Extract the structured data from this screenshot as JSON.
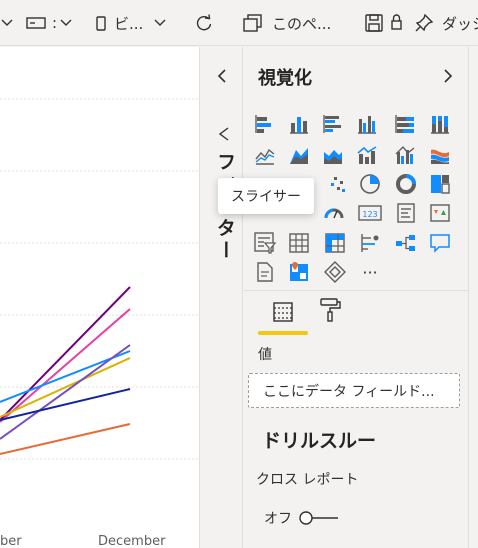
{
  "toolbar": {
    "item1_label": ":",
    "item2_label": "ビ...",
    "page_label": "このペ...",
    "item4_label": "ダッシ"
  },
  "visualizations": {
    "title": "視覚化",
    "tooltip": "スライサー",
    "more_label": "···"
  },
  "filters": {
    "vertical_label": "フィルター"
  },
  "fields": {
    "section_label": "値",
    "drop_placeholder": "ここにデータ フィールド..."
  },
  "drillthrough": {
    "title": "ドリルスルー",
    "cross_report_label": "クロス レポート",
    "toggle_state": "オフ"
  },
  "chart": {
    "x_label_left": "ber",
    "x_label_right": "December"
  },
  "colors": {
    "accent_yellow": "#f2c811",
    "icon_blue": "#118dff",
    "line_purple": "#6b007b",
    "line_pink": "#e044a7",
    "line_blue": "#118dff",
    "line_gold": "#d9b300",
    "line_violet": "#744ec2",
    "line_navy": "#12239e",
    "line_orange": "#e66c37"
  }
}
